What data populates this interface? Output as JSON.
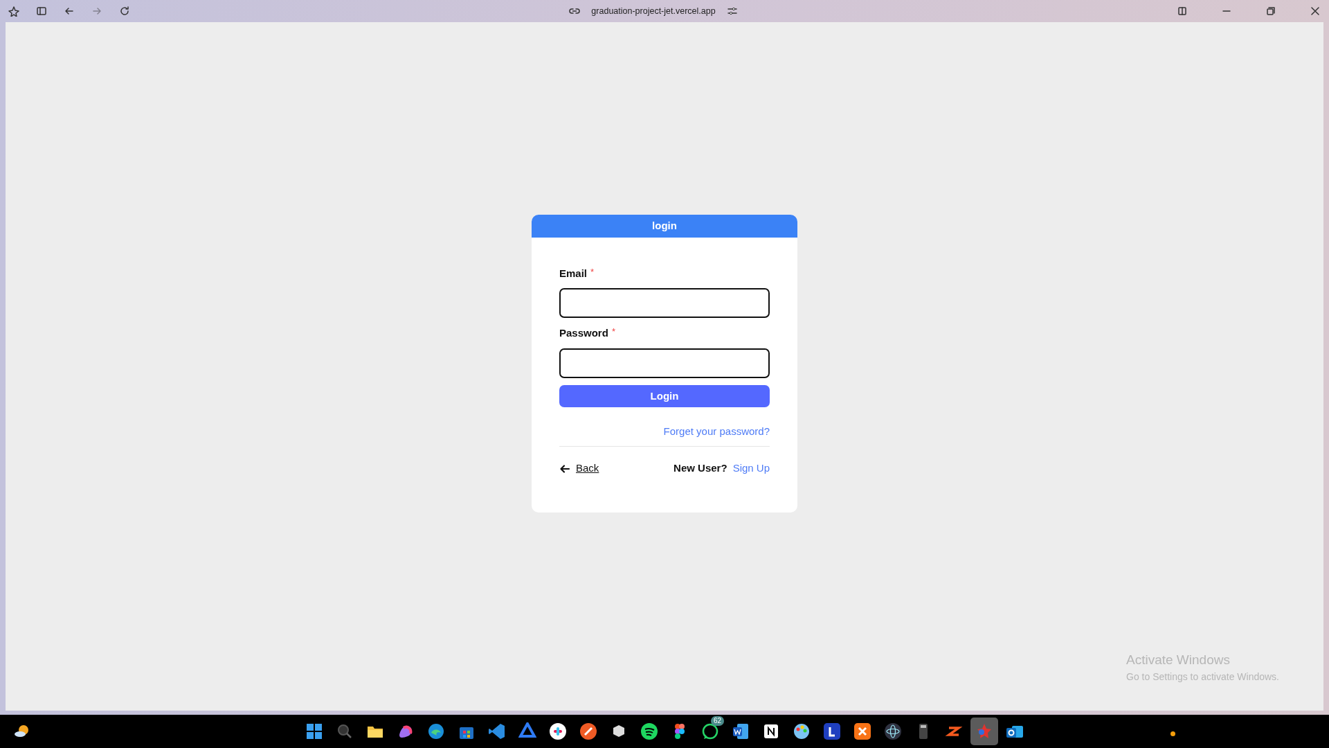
{
  "browser": {
    "address": "graduation-project-jet.vercel.app"
  },
  "login_card": {
    "title": "login",
    "fields": [
      {
        "label": "Email",
        "required_mark": "*"
      },
      {
        "label": "Password",
        "required_mark": "*"
      }
    ],
    "submit": "Login",
    "forgot_link": "Forget your password?",
    "back_link": "Back",
    "signup_prompt": "New User?",
    "signup_link": "Sign Up"
  },
  "activation_notice": {
    "title": "Activate Windows",
    "subtitle": "Go to Settings to activate Windows."
  },
  "taskbar": {
    "items": [
      {
        "selected": false
      },
      {
        "selected": false
      },
      {
        "selected": false
      },
      {
        "selected": false
      },
      {
        "selected": false
      },
      {
        "selected": false
      },
      {
        "selected": false
      },
      {
        "selected": false
      },
      {
        "selected": false
      },
      {
        "selected": false
      },
      {
        "selected": false
      },
      {
        "selected": false
      },
      {
        "selected": false
      },
      {
        "selected": false,
        "badge": "62"
      },
      {
        "selected": false
      },
      {
        "selected": false
      },
      {
        "selected": false
      },
      {
        "selected": false
      },
      {
        "selected": false
      },
      {
        "selected": false
      },
      {
        "selected": false
      },
      {
        "selected": false
      },
      {
        "selected": true
      },
      {
        "selected": false
      }
    ]
  }
}
